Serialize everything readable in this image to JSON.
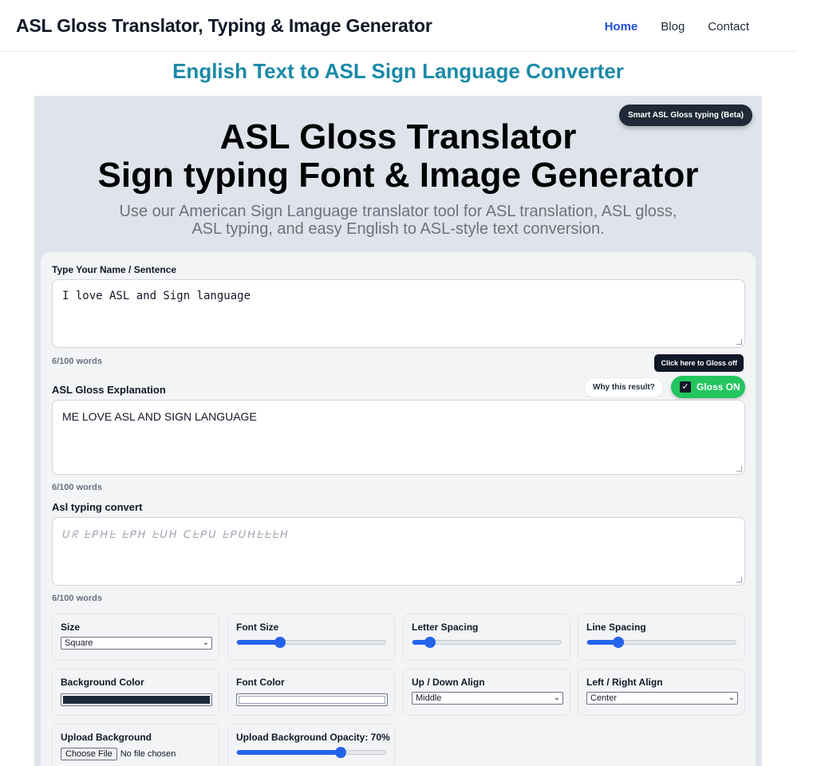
{
  "header": {
    "site_title": "ASL Gloss Translator, Typing & Image Generator",
    "nav": [
      {
        "label": "Home",
        "active": true
      },
      {
        "label": "Blog",
        "active": false
      },
      {
        "label": "Contact",
        "active": false
      }
    ]
  },
  "page_heading": "English Text to ASL Sign Language Converter",
  "hero": {
    "beta_badge": "Smart ASL Gloss typing (Beta)",
    "title_line1": "ASL Gloss Translator",
    "title_line2": "Sign typing Font & Image Generator",
    "subtitle_line1": "Use our American Sign Language translator tool for ASL translation, ASL gloss,",
    "subtitle_line2": "ASL typing, and easy English to ASL-style text conversion."
  },
  "form": {
    "input_label": "Type Your Name / Sentence",
    "input_value": "I love ASL and Sign language",
    "input_count": "6/100 words",
    "gloss_tooltip": "Click here to Gloss off",
    "gloss_label": "ASL Gloss Explanation",
    "why_button": "Why this result?",
    "gloss_toggle": "Gloss ON",
    "gloss_checked": true,
    "gloss_value": "ME LOVE ASL AND SIGN LANGUAGE",
    "gloss_count": "6/100 words",
    "typing_label": "Asl typing convert",
    "typing_value": "ᑌᖇ ᖶᑭᕼᖶ ᖶᑭᕼ ᖶᑌᕼ ᑕᖶᑭᑌ ᖶᑭᑌᕼᖶᖶᖶᕼ",
    "typing_count": "6/100 words"
  },
  "controls": {
    "size": {
      "label": "Size",
      "value": "Square"
    },
    "font_size": {
      "label": "Font Size",
      "level": 0.29
    },
    "letter_spacing": {
      "label": "Letter Spacing",
      "level": 0.12
    },
    "line_spacing": {
      "label": "Line Spacing",
      "level": 0.21
    },
    "background_color": {
      "label": "Background Color",
      "color": "#1e293b"
    },
    "font_color": {
      "label": "Font Color",
      "color": "#ffffff"
    },
    "up_down_align": {
      "label": "Up / Down Align",
      "value": "Middle"
    },
    "left_right_align": {
      "label": "Left / Right Align",
      "value": "Center"
    },
    "upload_background": {
      "label": "Upload Background",
      "button": "Choose File",
      "status": "No file chosen"
    },
    "upload_opacity": {
      "label": "Upload Background Opacity: 70%",
      "level": 0.7
    }
  },
  "colors": {
    "accent": "#1a8aa6",
    "nav_active": "#1d4ed8",
    "toggle_on": "#22c55e",
    "slider": "#2563eb"
  }
}
